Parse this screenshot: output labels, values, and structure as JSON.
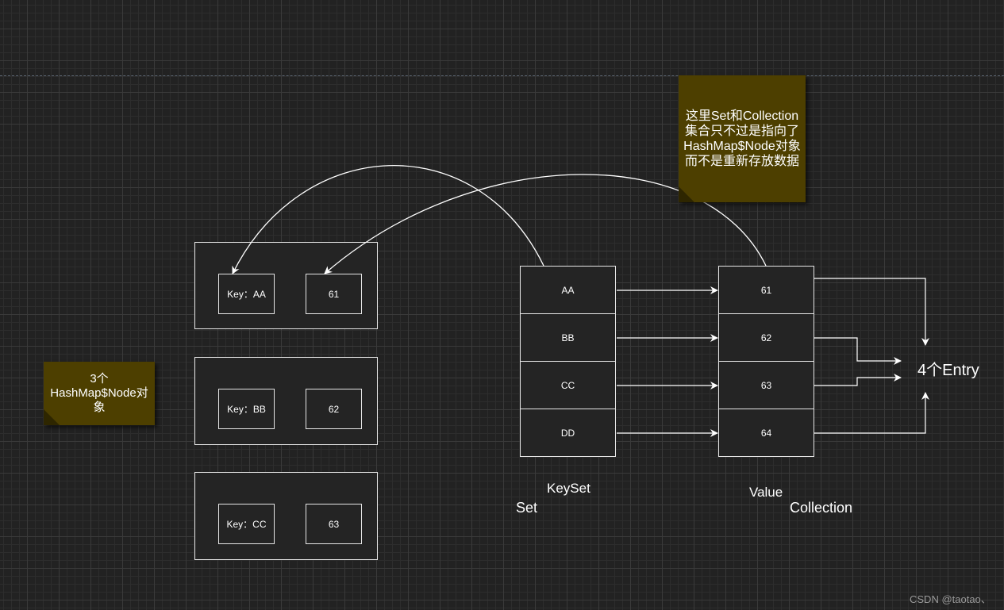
{
  "nodes": [
    {
      "key": "Key：AA",
      "value": "61"
    },
    {
      "key": "Key：BB",
      "value": "62"
    },
    {
      "key": "Key：CC",
      "value": "63"
    }
  ],
  "keyset_items": [
    "AA",
    "BB",
    "CC",
    "DD"
  ],
  "value_items": [
    "61",
    "62",
    "63",
    "64"
  ],
  "labels": {
    "keyset": "KeySet",
    "set": "Set",
    "value": "Value",
    "collection": "Collection",
    "entry": "4个Entry"
  },
  "notes": {
    "top_lines": [
      "这里Set和Collection",
      "集合只不过是指向了",
      "HashMap$Node对象",
      "而不是重新存放数据"
    ],
    "left_lines": [
      "3个",
      "HashMap$Node对",
      "象"
    ]
  },
  "watermark": "CSDN @taotao、",
  "colors": {
    "background": "#222222",
    "note_fill": "#4d3f00",
    "stroke": "#e6e6e6"
  }
}
